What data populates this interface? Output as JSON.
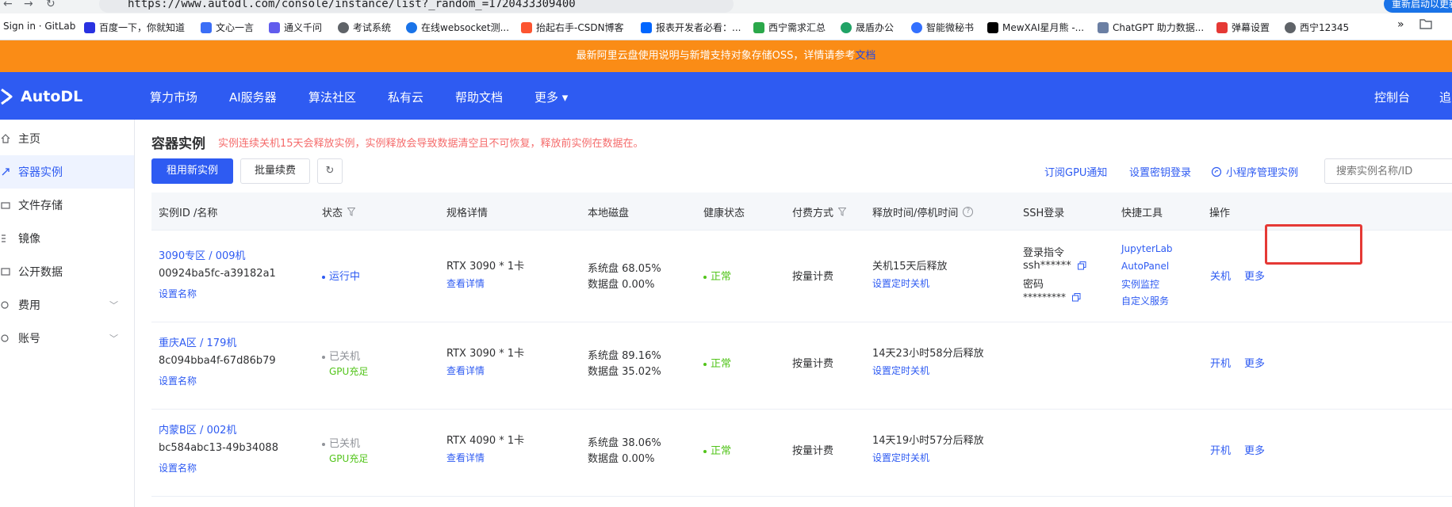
{
  "browser": {
    "url": "https://www.autodl.com/console/instance/list?_random_=1720433309400",
    "right_pill": "重新启动以更新",
    "bookmarks": [
      {
        "label": "Sign in · GitLab",
        "color": "#e24329"
      },
      {
        "label": "百度一下，你就知道",
        "color": "#2932e1"
      },
      {
        "label": "文心一言",
        "color": "#3b6ef6"
      },
      {
        "label": "通义千问",
        "color": "#615ced"
      },
      {
        "label": "考试系统",
        "color": "#5f6368"
      },
      {
        "label": "在线websocket测...",
        "color": "#1a73e8"
      },
      {
        "label": "抬起右手-CSDN博客",
        "color": "#fc5531"
      },
      {
        "label": "报表开发者必看：...",
        "color": "#0066ff"
      },
      {
        "label": "西宁需求汇总",
        "color": "#2ba84a"
      },
      {
        "label": "晟盾办公",
        "color": "#21a366"
      },
      {
        "label": "智能微秘书",
        "color": "#3370ff"
      },
      {
        "label": "MewXAI星月熊 -...",
        "color": "#000000"
      },
      {
        "label": "ChatGPT 助力数据...",
        "color": "#6b7fa3"
      },
      {
        "label": "弹幕设置",
        "color": "#e53935"
      },
      {
        "label": "西宁12345",
        "color": "#5f6368"
      }
    ],
    "overflow": "»"
  },
  "notice": {
    "text": "最新阿里云盘使用说明与新增支持对象存储OSS，详情请参考",
    "link": "文档"
  },
  "topnav": {
    "brand": "AutoDL",
    "items": [
      "算力市场",
      "AI服务器",
      "算法社区",
      "私有云",
      "帮助文档",
      "更多"
    ],
    "more_caret": "▾",
    "console": "控制台",
    "cut": "追"
  },
  "sidebar": {
    "items": [
      {
        "label": "主页",
        "icon": "home-icon"
      },
      {
        "label": "容器实例",
        "icon": "container-icon"
      },
      {
        "label": "文件存储",
        "icon": "folder-icon"
      },
      {
        "label": "镜像",
        "icon": "image-icon"
      },
      {
        "label": "公开数据",
        "icon": "data-icon"
      },
      {
        "label": "费用",
        "icon": "cost-icon"
      },
      {
        "label": "账号",
        "icon": "account-icon"
      }
    ]
  },
  "page": {
    "title": "容器实例",
    "warning": "实例连续关机15天会释放实例，实例释放会导致数据清空且不可恢复，释放前实例在数据在。",
    "rent_button": "租用新实例",
    "batch_button": "批量续费",
    "refresh_icon": "↻",
    "links": [
      "订阅GPU通知",
      "设置密钥登录",
      "小程序管理实例"
    ],
    "search_placeholder": "搜索实例名称/ID"
  },
  "table": {
    "columns": [
      "实例ID /名称",
      "状态",
      "规格详情",
      "本地磁盘",
      "健康状态",
      "付费方式",
      "释放时间/停机时间",
      "SSH登录",
      "快捷工具",
      "操作"
    ],
    "filter_icon": "filter-icon",
    "help_icon": "?",
    "rows": [
      {
        "name": "3090专区 / 009机",
        "id": "00924ba5fc-a39182a1",
        "set_name": "设置名称",
        "status": "运行中",
        "gpu_note": "",
        "spec": "RTX 3090 * 1卡",
        "spec_link": "查看详情",
        "disk_sys": "系统盘 68.05%",
        "disk_data": "数据盘 0.00%",
        "health": "正常",
        "pay": "按量计费",
        "release": "关机15天后释放",
        "release_link": "设置定时关机",
        "ssh_cmd_label": "登录指令",
        "ssh_cmd": "ssh******",
        "ssh_pwd_label": "密码",
        "ssh_pwd": "*********",
        "tools": [
          "JupyterLab",
          "AutoPanel",
          "实例监控",
          "自定义服务"
        ],
        "op1": "关机",
        "op2": "更多"
      },
      {
        "name": "重庆A区 / 179机",
        "id": "8c094bba4f-67d86b79",
        "set_name": "设置名称",
        "status": "已关机",
        "gpu_note": "GPU充足",
        "spec": "RTX 3090 * 1卡",
        "spec_link": "查看详情",
        "disk_sys": "系统盘 89.16%",
        "disk_data": "数据盘 35.02%",
        "health": "正常",
        "pay": "按量计费",
        "release": "14天23小时58分后释放",
        "release_link": "设置定时关机",
        "op1": "开机",
        "op2": "更多"
      },
      {
        "name": "内蒙B区 / 002机",
        "id": "bc584abc13-49b34088",
        "set_name": "设置名称",
        "status": "已关机",
        "gpu_note": "GPU充足",
        "spec": "RTX 4090 * 1卡",
        "spec_link": "查看详情",
        "disk_sys": "系统盘 38.06%",
        "disk_data": "数据盘 0.00%",
        "health": "正常",
        "pay": "按量计费",
        "release": "14天19小时57分后释放",
        "release_link": "设置定时关机",
        "op1": "开机",
        "op2": "更多"
      }
    ]
  },
  "colors": {
    "brand": "#2e5bf2",
    "notice": "#fa8c16",
    "ok": "#52c41a",
    "warn": "#f56c6c",
    "highlight": "#e53935"
  }
}
